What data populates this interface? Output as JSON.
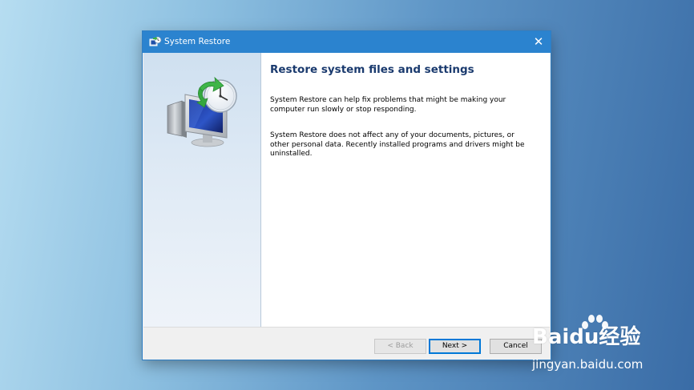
{
  "window": {
    "title": "System Restore",
    "close_glyph": "✕"
  },
  "content": {
    "heading": "Restore system files and settings",
    "paragraph1": "System Restore can help fix problems that might be making your computer run slowly or stop responding.",
    "paragraph2": "System Restore does not affect any of your documents, pictures, or other personal data. Recently installed programs and drivers might be uninstalled."
  },
  "buttons": {
    "back": "< Back",
    "next": "Next >",
    "cancel": "Cancel"
  },
  "icons": {
    "title_icon": "system-restore-icon",
    "illustration": "computer-restore-clock-icon"
  },
  "watermark": {
    "logo": "Baidu经验",
    "url": "jingyan.baidu.com"
  },
  "colors": {
    "titlebar": "#2b83cf",
    "heading": "#1a3a6e",
    "accent_button_border": "#0078d7"
  }
}
